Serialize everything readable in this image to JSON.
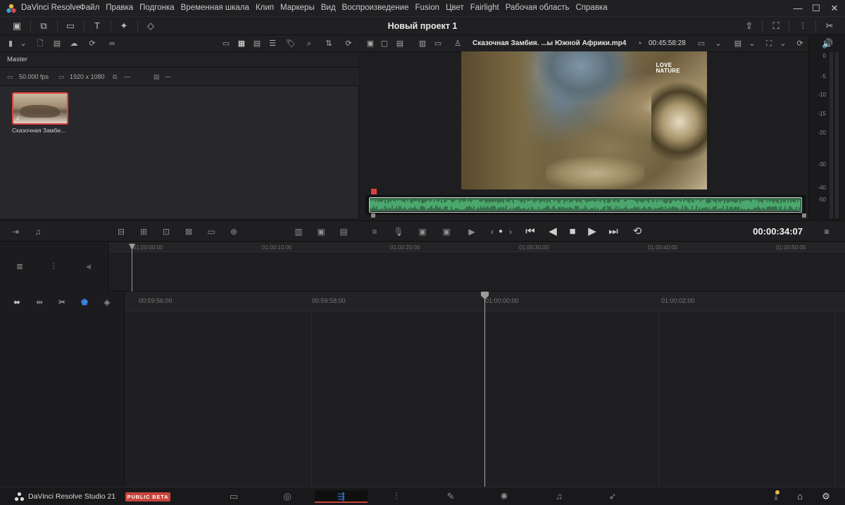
{
  "app_title": "DaVinci Resolve",
  "menu": [
    "Файл",
    "Правка",
    "Подгонка",
    "Временная шкала",
    "Клип",
    "Маркеры",
    "Вид",
    "Воспроизведение",
    "Fusion",
    "Цвет",
    "Fairlight",
    "Рабочая область",
    "Справка"
  ],
  "project_title": "Новый проект 1",
  "media_pool": {
    "bin_name": "Master",
    "fps": "50.000 fps",
    "resolution": "1920 x 1080",
    "field3": "---",
    "field4": "---",
    "clip_name": "Сказочная Замби..."
  },
  "viewer": {
    "clip_title": "Сказочная Замбия. ...ы Южной Африки.mp4",
    "duration": "00:45:58:28",
    "watermark_line1": "LOVE",
    "watermark_line2": "NATURE",
    "timecode": "00:00:34:07"
  },
  "meters": {
    "labels": [
      "0",
      "-5",
      "-10",
      "-15",
      "-20",
      "-30",
      "-40",
      "-50"
    ]
  },
  "upper_ruler": [
    "01:00:00:00",
    "01:00:10:00",
    "01:00:20:00",
    "01:00:30:00",
    "01:00:40:00",
    "01:00:50:00"
  ],
  "lower_ruler": [
    "00:59:56:00",
    "00:59:58:00",
    "01:00:00:00",
    "01:00:02:00"
  ],
  "bottom": {
    "product": "DaVinci Resolve Studio 21",
    "badge": "PUBLIC BETA"
  },
  "colors": {
    "accent_red": "#e04040",
    "waveform_green": "#4ba86c",
    "active_page": "#3b7de0"
  }
}
